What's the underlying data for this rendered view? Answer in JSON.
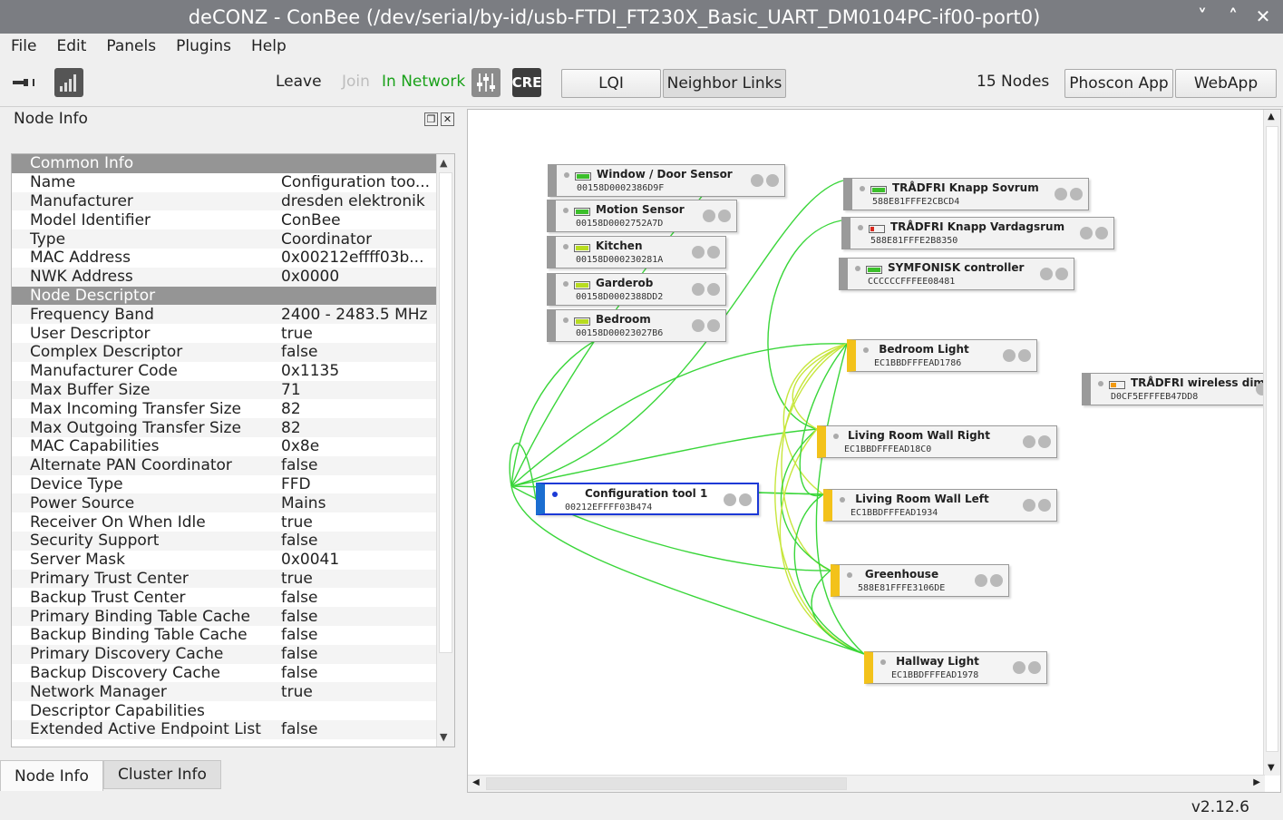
{
  "window": {
    "title": "deCONZ - ConBee (/dev/serial/by-id/usb-FTDI_FT230X_Basic_UART_DM0104PC-if00-port0)",
    "min_glyph": "˅",
    "max_glyph": "˄",
    "close_glyph": "✕"
  },
  "menu": [
    "File",
    "Edit",
    "Panels",
    "Plugins",
    "Help"
  ],
  "toolbar": {
    "leave": "Leave",
    "join": "Join",
    "in_network": "In Network",
    "cre": "CRE",
    "lqi": "LQI",
    "neighbor_links": "Neighbor Links",
    "nodes_count": "15 Nodes",
    "phoscon": "Phoscon App",
    "webapp": "WebApp"
  },
  "node_info": {
    "title": "Node Info",
    "rows": [
      {
        "section": "Common Info"
      },
      {
        "k": "Name",
        "v": "Configuration too..."
      },
      {
        "k": "Manufacturer",
        "v": "dresden elektronik"
      },
      {
        "k": "Model Identifier",
        "v": "ConBee"
      },
      {
        "k": "Type",
        "v": "Coordinator"
      },
      {
        "k": "MAC Address",
        "v": "0x00212effff03b..."
      },
      {
        "k": "NWK Address",
        "v": "0x0000"
      },
      {
        "section": "Node Descriptor"
      },
      {
        "k": "Frequency Band",
        "v": "2400 - 2483.5 MHz"
      },
      {
        "k": "User Descriptor",
        "v": "true"
      },
      {
        "k": "Complex Descriptor",
        "v": "false"
      },
      {
        "k": "Manufacturer Code",
        "v": "0x1135"
      },
      {
        "k": "Max Buffer Size",
        "v": "71"
      },
      {
        "k": "Max Incoming Transfer Size",
        "v": "82"
      },
      {
        "k": "Max Outgoing Transfer Size",
        "v": "82"
      },
      {
        "k": "MAC Capabilities",
        "v": "0x8e"
      },
      {
        "k": "Alternate PAN Coordinator",
        "v": "false"
      },
      {
        "k": "Device Type",
        "v": "FFD"
      },
      {
        "k": "Power Source",
        "v": "Mains"
      },
      {
        "k": "Receiver On When Idle",
        "v": "true"
      },
      {
        "k": "Security Support",
        "v": "false"
      },
      {
        "k": "Server Mask",
        "v": "0x0041"
      },
      {
        "k": "Primary Trust Center",
        "v": "true"
      },
      {
        "k": "Backup Trust Center",
        "v": "false"
      },
      {
        "k": "Primary Binding Table Cache",
        "v": "false"
      },
      {
        "k": "Backup Binding Table Cache",
        "v": "false"
      },
      {
        "k": "Primary Discovery Cache",
        "v": "false"
      },
      {
        "k": "Backup Discovery Cache",
        "v": "false"
      },
      {
        "k": "Network Manager",
        "v": "true"
      },
      {
        "k": "Descriptor Capabilities",
        "v": ""
      },
      {
        "k": "Extended Active Endpoint List",
        "v": "false"
      }
    ]
  },
  "tabs": [
    "Node Info",
    "Cluster Info"
  ],
  "graph": {
    "nodes": [
      {
        "id": "n1",
        "name": "Window / Door Sensor",
        "addr": "00158D0002386D9F",
        "kind": "gray",
        "battery": "green"
      },
      {
        "id": "n2",
        "name": "Motion Sensor",
        "addr": "00158D0002752A7D",
        "kind": "gray",
        "battery": "green"
      },
      {
        "id": "n3",
        "name": "Kitchen",
        "addr": "00158D000230281A",
        "kind": "gray",
        "battery": "lime"
      },
      {
        "id": "n4",
        "name": "Garderob",
        "addr": "00158D0002388DD2",
        "kind": "gray",
        "battery": "lime"
      },
      {
        "id": "n5",
        "name": "Bedroom",
        "addr": "00158D00023027B6",
        "kind": "gray",
        "battery": "lime"
      },
      {
        "id": "n6",
        "name": "TRÅDFRI Knapp Sovrum",
        "addr": "588E81FFFE2CBCD4",
        "kind": "gray",
        "battery": "green"
      },
      {
        "id": "n7",
        "name": "TRÅDFRI Knapp Vardagsrum",
        "addr": "588E81FFFE2B8350",
        "kind": "gray",
        "battery": "red"
      },
      {
        "id": "n8",
        "name": "SYMFONISK controller",
        "addr": "CCCCCCFFFEE08481",
        "kind": "gray",
        "battery": "green"
      },
      {
        "id": "n9",
        "name": "Bedroom Light",
        "addr": "EC1BBDFFFEAD1786",
        "kind": "yellow"
      },
      {
        "id": "n10",
        "name": "TRÅDFRI wireless dim",
        "addr": "D0CF5EFFFEB47DD8",
        "kind": "gray",
        "battery": "orange"
      },
      {
        "id": "n11",
        "name": "Living Room Wall Right",
        "addr": "EC1BBDFFFEAD18C0",
        "kind": "yellow"
      },
      {
        "id": "n12",
        "name": "Configuration tool 1",
        "addr": "00212EFFFF03B474",
        "kind": "sel"
      },
      {
        "id": "n13",
        "name": "Living Room Wall Left",
        "addr": "EC1BBDFFFEAD1934",
        "kind": "yellow"
      },
      {
        "id": "n14",
        "name": "Greenhouse",
        "addr": "588E81FFFE3106DE",
        "kind": "yellow"
      },
      {
        "id": "n15",
        "name": "Hallway Light",
        "addr": "EC1BBDFFFEAD1978",
        "kind": "yellow"
      }
    ]
  },
  "version": "v2.12.6",
  "colors": {
    "link_strong": "#3ad63a",
    "link_weak": "#c7e63c",
    "selected": "#1c39d6",
    "router": "#f3c21a"
  }
}
